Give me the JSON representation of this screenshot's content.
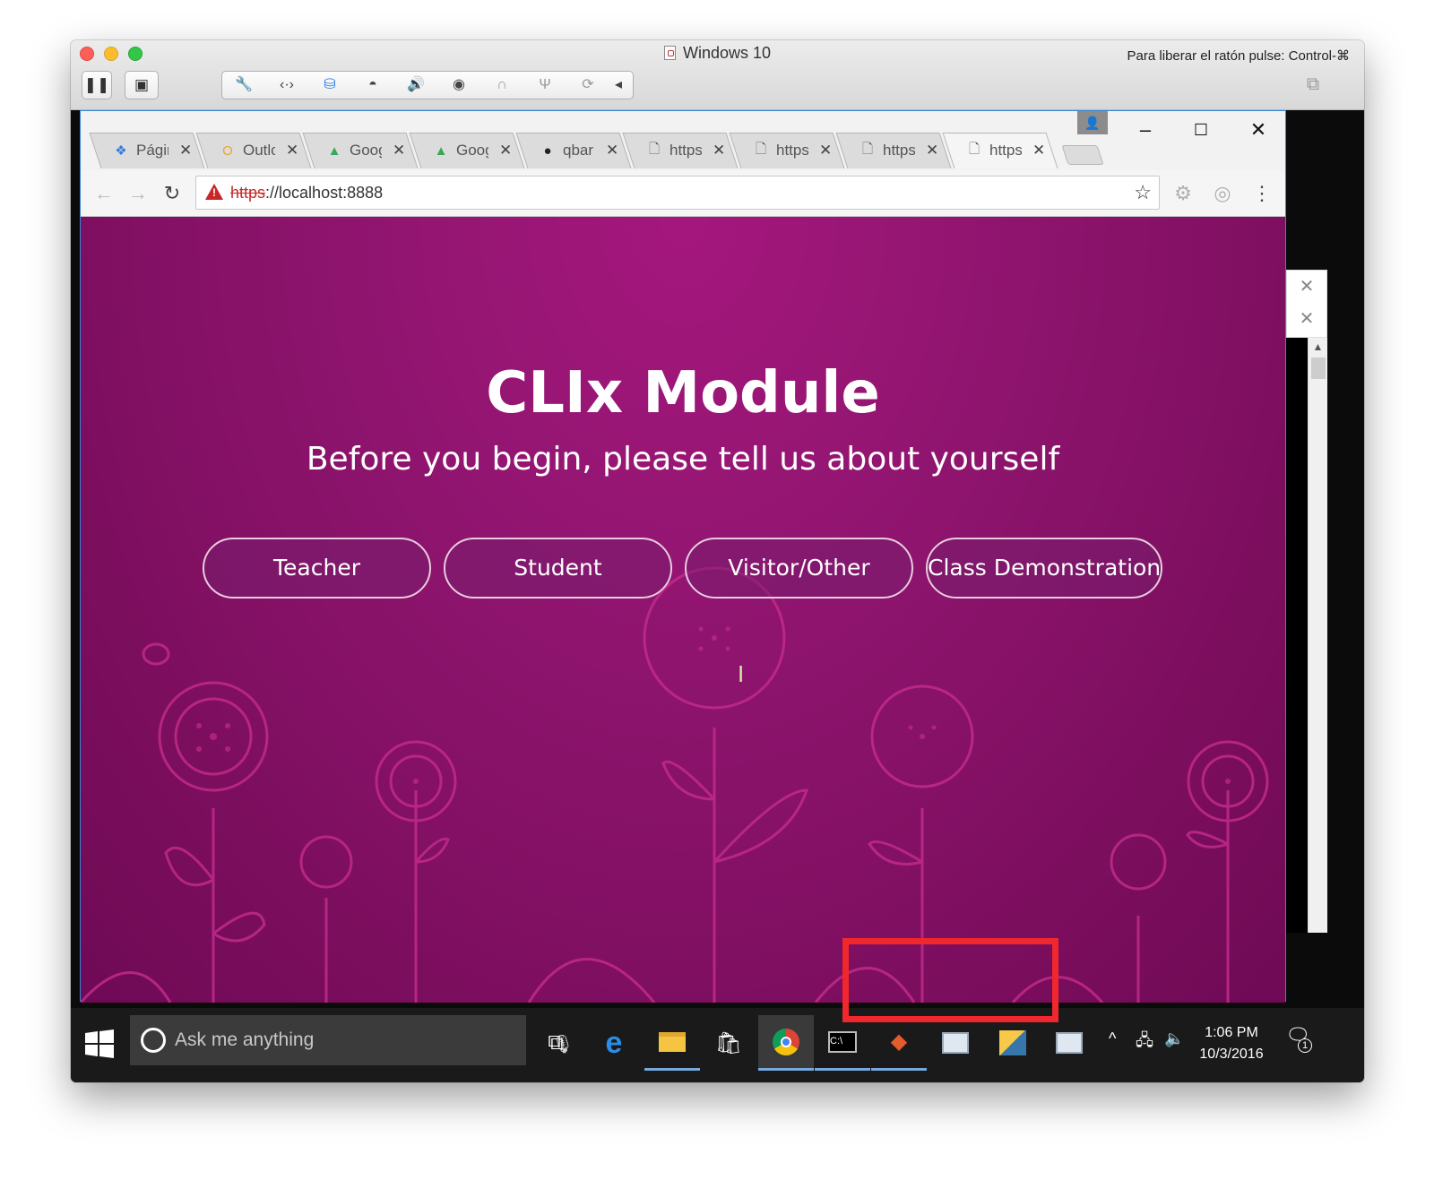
{
  "mac_window": {
    "title": "Windows 10",
    "release_hint": "Para liberar el ratón pulse: Control-⌘",
    "toolbar_icons": [
      "wrench-icon",
      "network-icon",
      "drive-icon",
      "camera-icon",
      "volume-icon",
      "screenshot-icon",
      "headphones-icon",
      "usb-icon",
      "sync-icon",
      "collapse-icon"
    ]
  },
  "browser": {
    "tabs": [
      {
        "title": "Págir",
        "icon": "dropbox-icon"
      },
      {
        "title": "Outlc",
        "icon": "outlook-icon"
      },
      {
        "title": "Goog",
        "icon": "google-drive-icon"
      },
      {
        "title": "Goog",
        "icon": "google-drive-icon"
      },
      {
        "title": "qbar",
        "icon": "github-icon"
      },
      {
        "title": "https",
        "icon": "page-icon"
      },
      {
        "title": "https",
        "icon": "page-icon"
      },
      {
        "title": "https",
        "icon": "page-icon"
      },
      {
        "title": "https",
        "icon": "page-icon",
        "active": true
      }
    ],
    "url_scheme": "https",
    "url_rest": "://localhost:8888",
    "window_controls": {
      "minimize": "–",
      "maximize": "☐",
      "close": "✕"
    }
  },
  "page": {
    "title": "CLIx Module",
    "subtitle": "Before you begin, please tell us about yourself",
    "roles": [
      "Teacher",
      "Student",
      "Visitor/Other",
      "Class Demonstration"
    ],
    "background_color": "#911570",
    "accent_line_color": "#c22a8b"
  },
  "taskbar": {
    "search_placeholder": "Ask me anything",
    "time": "1:06 PM",
    "date": "10/3/2016",
    "notification_count": "1",
    "highlight_color": "#f0282d"
  }
}
